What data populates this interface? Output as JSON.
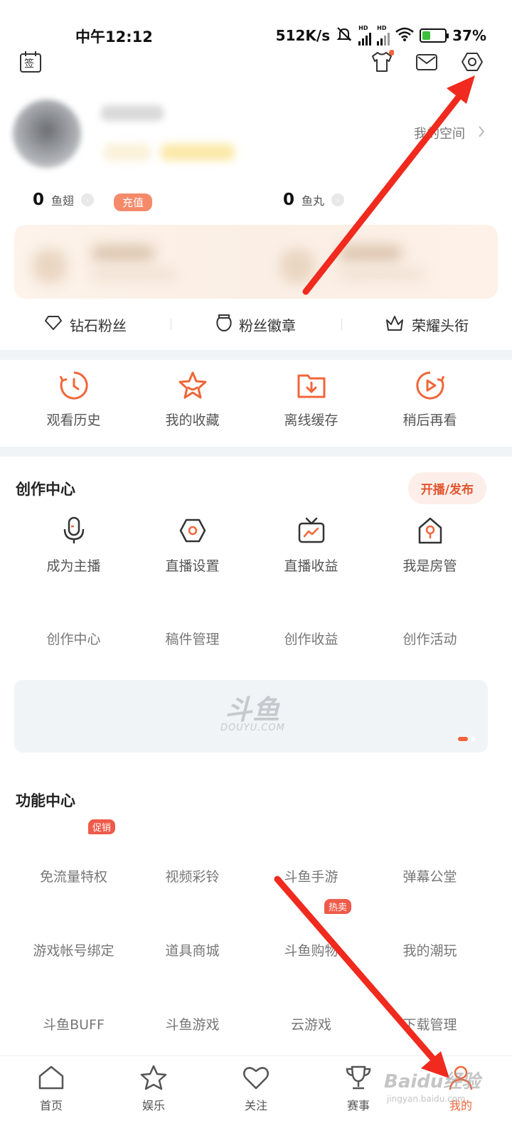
{
  "status_bar": {
    "time": "中午12:12",
    "speed": "512K/s",
    "network_label": "HD",
    "battery": "37%",
    "battery_level": 0.37
  },
  "top_bar": {
    "left_icon": "sign-in-calendar-icon",
    "sign_in_glyph": "签",
    "right_icons": [
      "shirt-icon",
      "mail-icon",
      "settings-icon"
    ]
  },
  "profile": {
    "space_link": "我的空间"
  },
  "wallet": {
    "fish_wing_count": "0",
    "fish_wing_label": "鱼翅",
    "recharge_label": "充值",
    "fish_ball_count": "0",
    "fish_ball_label": "鱼丸"
  },
  "fan_row": [
    {
      "label": "钻石粉丝",
      "icon": "diamond-icon"
    },
    {
      "label": "粉丝徽章",
      "icon": "badge-icon"
    },
    {
      "label": "荣耀头衔",
      "icon": "crown-icon"
    }
  ],
  "quick_actions": [
    {
      "label": "观看历史",
      "icon": "history-icon"
    },
    {
      "label": "我的收藏",
      "icon": "star-icon"
    },
    {
      "label": "离线缓存",
      "icon": "download-folder-icon"
    },
    {
      "label": "稍后再看",
      "icon": "play-later-icon"
    }
  ],
  "creation": {
    "title": "创作中心",
    "live_button": "开播/发布",
    "row1": [
      {
        "label": "成为主播",
        "icon": "microphone-icon"
      },
      {
        "label": "直播设置",
        "icon": "live-settings-icon"
      },
      {
        "label": "直播收益",
        "icon": "tv-income-icon"
      },
      {
        "label": "我是房管",
        "icon": "room-admin-icon"
      }
    ],
    "row2": [
      "创作中心",
      "稿件管理",
      "创作收益",
      "创作活动"
    ]
  },
  "banner": {
    "logo_text": "斗鱼",
    "logo_sub": "DOUYU.COM"
  },
  "functions": {
    "title": "功能中心",
    "row1": [
      "免流量特权",
      "视频彩铃",
      "斗鱼手游",
      "弹幕公堂"
    ],
    "row1_badge": "促销",
    "row2": [
      "游戏帐号绑定",
      "道具商城",
      "斗鱼购物",
      "我的潮玩"
    ],
    "row2_badge": "热卖",
    "row3": [
      "斗鱼BUFF",
      "斗鱼游戏",
      "云游戏",
      "下载管理"
    ]
  },
  "tab_bar": [
    {
      "label": "首页",
      "icon": "home-icon"
    },
    {
      "label": "娱乐",
      "icon": "star-icon"
    },
    {
      "label": "关注",
      "icon": "heart-icon"
    },
    {
      "label": "赛事",
      "icon": "trophy-icon"
    },
    {
      "label": "我的",
      "icon": "user-icon"
    }
  ],
  "watermark": {
    "text": "Baidu经验",
    "sub": "jingyan.baidu.com"
  },
  "colors": {
    "accent": "#f0663a",
    "annotation_arrow": "#f02a1e"
  }
}
